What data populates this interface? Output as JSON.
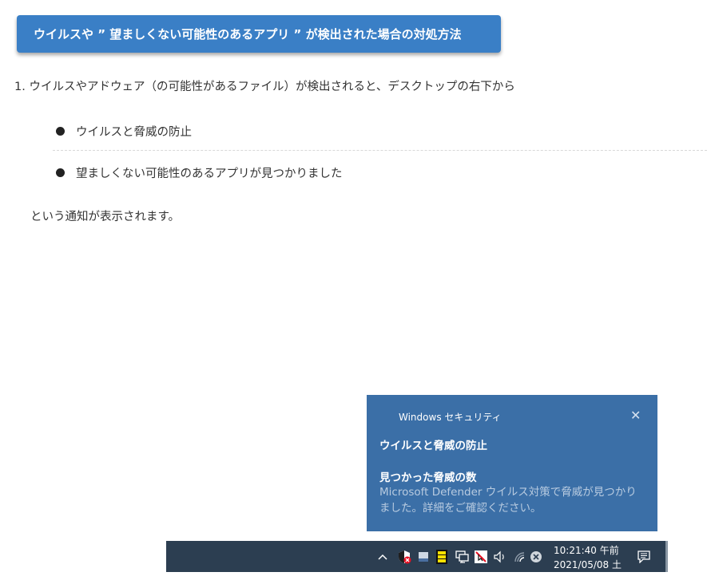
{
  "article": {
    "heading": "ウイルスや ” 望ましくない可能性のあるアプリ ” が検出された場合の対処方法",
    "step": "1. ウイルスやアドウェア（の可能性があるファイル）が検出されると、デスクトップの右下から",
    "bullets": [
      "ウイルスと脅威の防止",
      "望ましくない可能性のあるアプリが見つかりました"
    ],
    "note": "という通知が表示されます。"
  },
  "toast": {
    "app_name": "Windows セキュリティ",
    "close": "✕",
    "title": "ウイルスと脅威の防止",
    "subtitle": "見つかった脅威の数",
    "body": "Microsoft Defender ウイルス対策で脅威が見つかりました。詳細をご確認ください。"
  },
  "taskbar": {
    "time": "10:21:40 午前",
    "date": "2021/05/08 土",
    "icons": [
      "chevron-up-icon",
      "shield-alert-icon",
      "device-icon",
      "battery-icon",
      "network-icon",
      "blocked-app-icon",
      "speaker-icon",
      "wifi-icon",
      "close-circle-icon",
      "notification-icon"
    ]
  }
}
